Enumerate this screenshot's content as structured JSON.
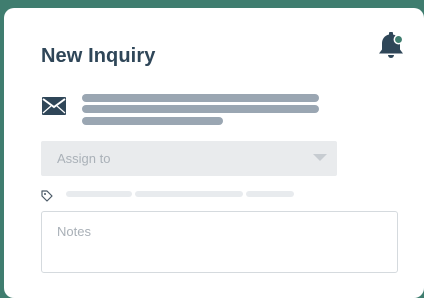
{
  "form": {
    "title": "New Inquiry",
    "assign_placeholder": "Assign to",
    "notes_placeholder": "Notes"
  },
  "icons": {
    "bell": "bell-icon",
    "mail": "mail-icon",
    "tag": "tag-icon",
    "dropdown": "chevron-down-icon"
  },
  "colors": {
    "background": "#3f7d6f",
    "title": "#2f4658",
    "notification_dot": "#3f7d6f"
  }
}
